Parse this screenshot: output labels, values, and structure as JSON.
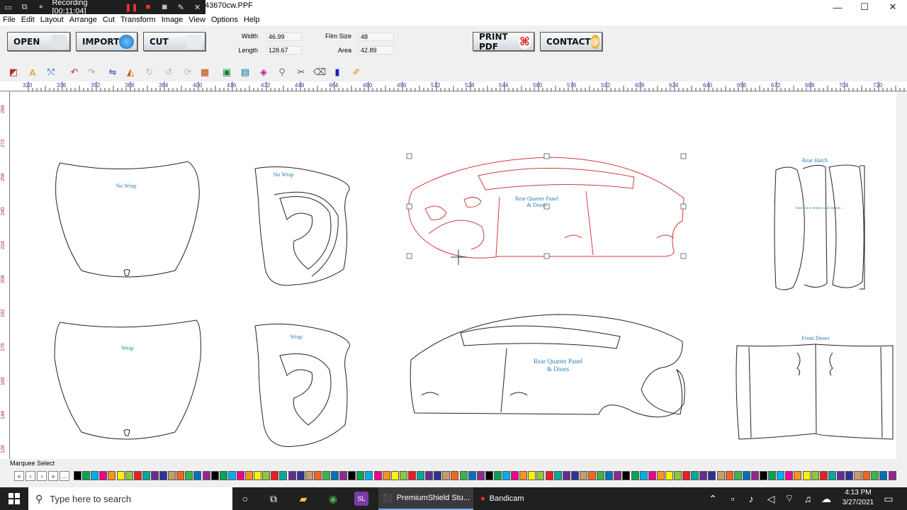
{
  "recording": {
    "label": "Recording [00:11:04]"
  },
  "window": {
    "title": "43670cw.PPF"
  },
  "menu": [
    "File",
    "Edit",
    "Layout",
    "Arrange",
    "Cut",
    "Transform",
    "Image",
    "View",
    "Options",
    "Help"
  ],
  "buttons": {
    "open": "OPEN",
    "import": "IMPORT",
    "cut": "CUT",
    "print_pdf": "PRINT PDF",
    "contact": "CONTACT"
  },
  "fields": {
    "width_label": "Width",
    "width_value": "46.99",
    "length_label": "Length",
    "length_value": "128.67",
    "film_label": "Film Size",
    "film_value": "48",
    "area_label": "Area",
    "area_value": "42.89"
  },
  "ruler_top": [
    "320",
    "336",
    "352",
    "368",
    "384",
    "400",
    "416",
    "432",
    "448",
    "464",
    "480",
    "496",
    "512",
    "528",
    "544",
    "560",
    "576",
    "592",
    "608",
    "624",
    "640",
    "656",
    "672",
    "688",
    "704",
    "720"
  ],
  "ruler_left": [
    "288",
    "272",
    "256",
    "240",
    "224",
    "208",
    "192",
    "176",
    "160",
    "144",
    "128"
  ],
  "pieces": {
    "hood_top": "No Wrap",
    "fender_top": "No Wrap",
    "quarter_top": "Rear Quarter Panel\n& Doors",
    "rear_hatch": "Rear Hatch",
    "rear_hatch_inner": "hood cut to remove and replace ...",
    "hood_bottom": "Wrap",
    "fender_bottom": "Wrap",
    "quarter_bottom": "Rear Quarter Panel\n& Doors",
    "front_doors": "Front Doors"
  },
  "status": {
    "text": "Marquee Select"
  },
  "nav": [
    "«",
    "‹",
    "›",
    "»",
    "..."
  ],
  "swatches": [
    "#000000",
    "#00a651",
    "#00aeef",
    "#ec008c",
    "#f7941d",
    "#fff200",
    "#8dc63f",
    "#ed1c24",
    "#00a99d",
    "#662d91",
    "#2e3192",
    "#c69c6d",
    "#f26522",
    "#39b54a",
    "#0072bc",
    "#92278f"
  ],
  "taskbar": {
    "search_placeholder": "Type here to search",
    "app1": "PremiumShield Stu...",
    "app2": "Bandicam",
    "time": "4:13 PM",
    "date": "3/27/2021"
  }
}
